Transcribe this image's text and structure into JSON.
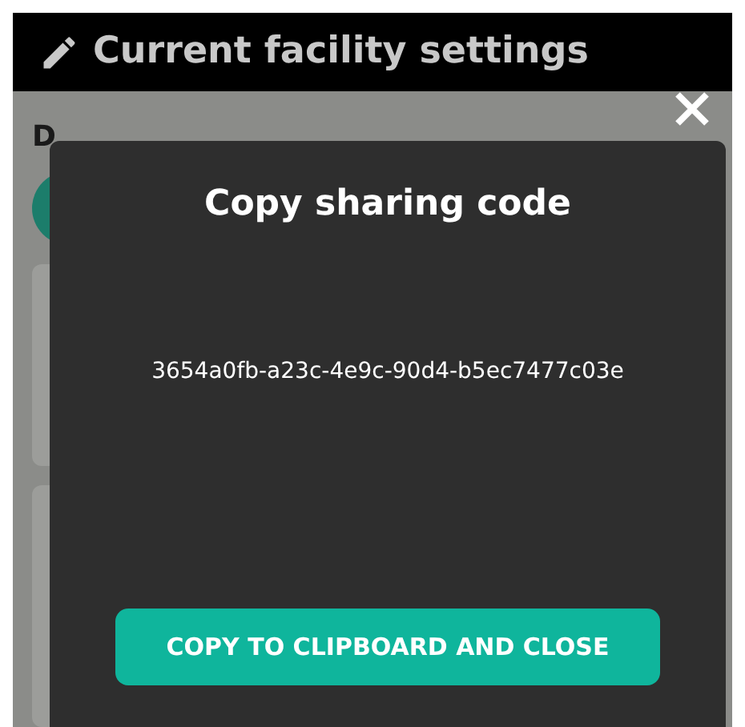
{
  "header": {
    "title": "Current facility settings"
  },
  "background": {
    "label": "D"
  },
  "dialog": {
    "title": "Copy sharing code",
    "code": "3654a0fb-a23c-4e9c-90d4-b5ec7477c03e",
    "button": "COPY TO CLIPBOARD AND CLOSE"
  }
}
